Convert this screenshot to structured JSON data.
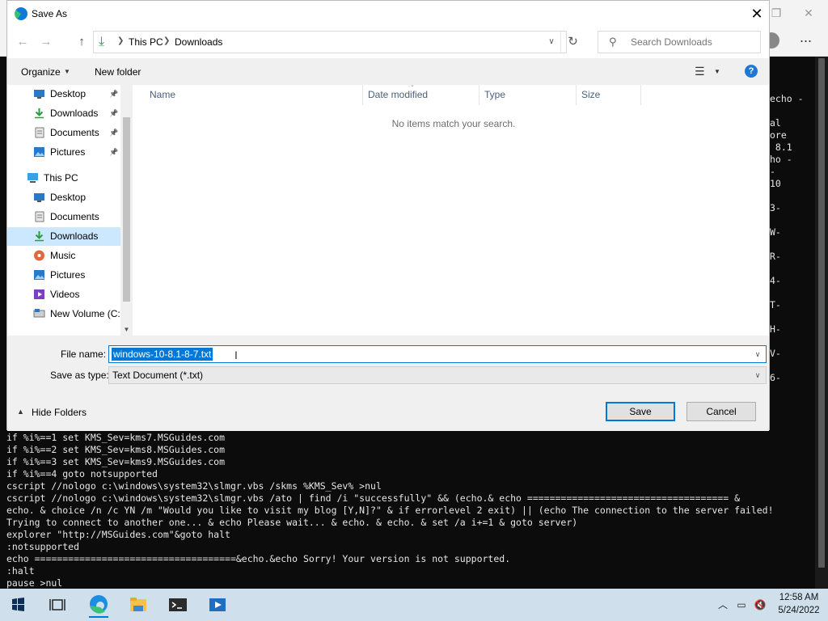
{
  "dialog": {
    "title": "Save As",
    "breadcrumb": [
      "This PC",
      "Downloads"
    ],
    "search_placeholder": "Search Downloads",
    "toolbar": {
      "organize": "Organize",
      "new_folder": "New folder"
    },
    "nav_items": [
      {
        "label": "Desktop",
        "icon": "desktop-icon",
        "pinned": true
      },
      {
        "label": "Downloads",
        "icon": "downloads-icon",
        "pinned": true
      },
      {
        "label": "Documents",
        "icon": "documents-icon",
        "pinned": true
      },
      {
        "label": "Pictures",
        "icon": "pictures-icon",
        "pinned": true
      },
      {
        "label": "This PC",
        "icon": "pc-icon"
      },
      {
        "label": "Desktop",
        "icon": "desktop-icon"
      },
      {
        "label": "Documents",
        "icon": "documents-icon"
      },
      {
        "label": "Downloads",
        "icon": "downloads-icon",
        "selected": true
      },
      {
        "label": "Music",
        "icon": "music-icon"
      },
      {
        "label": "Pictures",
        "icon": "pictures-icon"
      },
      {
        "label": "Videos",
        "icon": "videos-icon"
      },
      {
        "label": "New Volume (C:",
        "icon": "drive-icon"
      }
    ],
    "columns": [
      "Name",
      "Date modified",
      "Type",
      "Size"
    ],
    "empty_message": "No items match your search.",
    "file_name_label": "File name:",
    "file_name_value": "windows-10-8.1-8-7.txt",
    "save_type_label": "Save as type:",
    "save_type_value": "Text Document (*.txt)",
    "hide_folders": "Hide Folders",
    "save_button": "Save",
    "cancel_button": "Cancel"
  },
  "background_code": {
    "right_fragments": [
      "echo -",
      "",
      "al",
      "ore",
      " 8.1",
      "ho -",
      "-",
      "10",
      "",
      "3-",
      "",
      "W-",
      "",
      "R-",
      "",
      "4-",
      "",
      "T-",
      "",
      "H-",
      "",
      "V-",
      "",
      "6-"
    ],
    "lines": [
      "if %i%==1 set KMS_Sev=kms7.MSGuides.com",
      "if %i%==2 set KMS_Sev=kms8.MSGuides.com",
      "if %i%==3 set KMS_Sev=kms9.MSGuides.com",
      "if %i%==4 goto notsupported",
      "cscript //nologo c:\\windows\\system32\\slmgr.vbs /skms %KMS_Sev% >nul",
      "cscript //nologo c:\\windows\\system32\\slmgr.vbs /ato | find /i \"successfully\" && (echo.& echo ==================================== &",
      "echo. & choice /n /c YN /m \"Would you like to visit my blog [Y,N]?\" & if errorlevel 2 exit) || (echo The connection to the server failed!",
      "Trying to connect to another one... & echo Please wait... & echo. & echo. & set /a i+=1 & goto server)",
      "explorer \"http://MSGuides.com\"&goto halt",
      ":notsupported",
      "echo ====================================&echo.&echo Sorry! Your version is not supported.",
      ":halt",
      "pause >nul"
    ]
  },
  "taskbar": {
    "items": [
      "start-icon",
      "task-view-icon",
      "edge-icon",
      "file-explorer-icon",
      "terminal-icon",
      "app-icon"
    ],
    "time": "12:58 AM",
    "date": "5/24/2022"
  },
  "colors": {
    "accent": "#0078d7",
    "selection": "#cce8ff",
    "taskbar": "#cfe0ec",
    "console_bg": "#0c0c0c"
  }
}
